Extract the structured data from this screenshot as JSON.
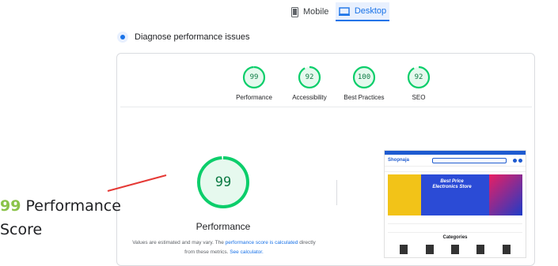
{
  "tabs": {
    "mobile_label": "Mobile",
    "desktop_label": "Desktop"
  },
  "diagnose": {
    "title": "Diagnose performance issues"
  },
  "summary_gauges": [
    {
      "score": "99",
      "label": "Performance"
    },
    {
      "score": "92",
      "label": "Accessibility"
    },
    {
      "score": "100",
      "label": "Best Practices"
    },
    {
      "score": "92",
      "label": "SEO"
    }
  ],
  "main_gauge": {
    "score": "99",
    "label": "Performance",
    "note_prefix": "Values are estimated and may vary. The ",
    "note_link1": "performance score is calculated",
    "note_middle": " directly from these metrics. ",
    "note_link2": "See calculator."
  },
  "annotation": {
    "number": "99",
    "line1": " Performance",
    "line2": "Score"
  },
  "thumbnail": {
    "logo": "Shopnaja",
    "banner_line1": "Best Price",
    "banner_line2": "Electronics Store",
    "categories_heading": "Categories"
  },
  "colors": {
    "pass": "#0cce6b",
    "accent": "#1a73e8",
    "annotation_number": "#8bc34a"
  }
}
